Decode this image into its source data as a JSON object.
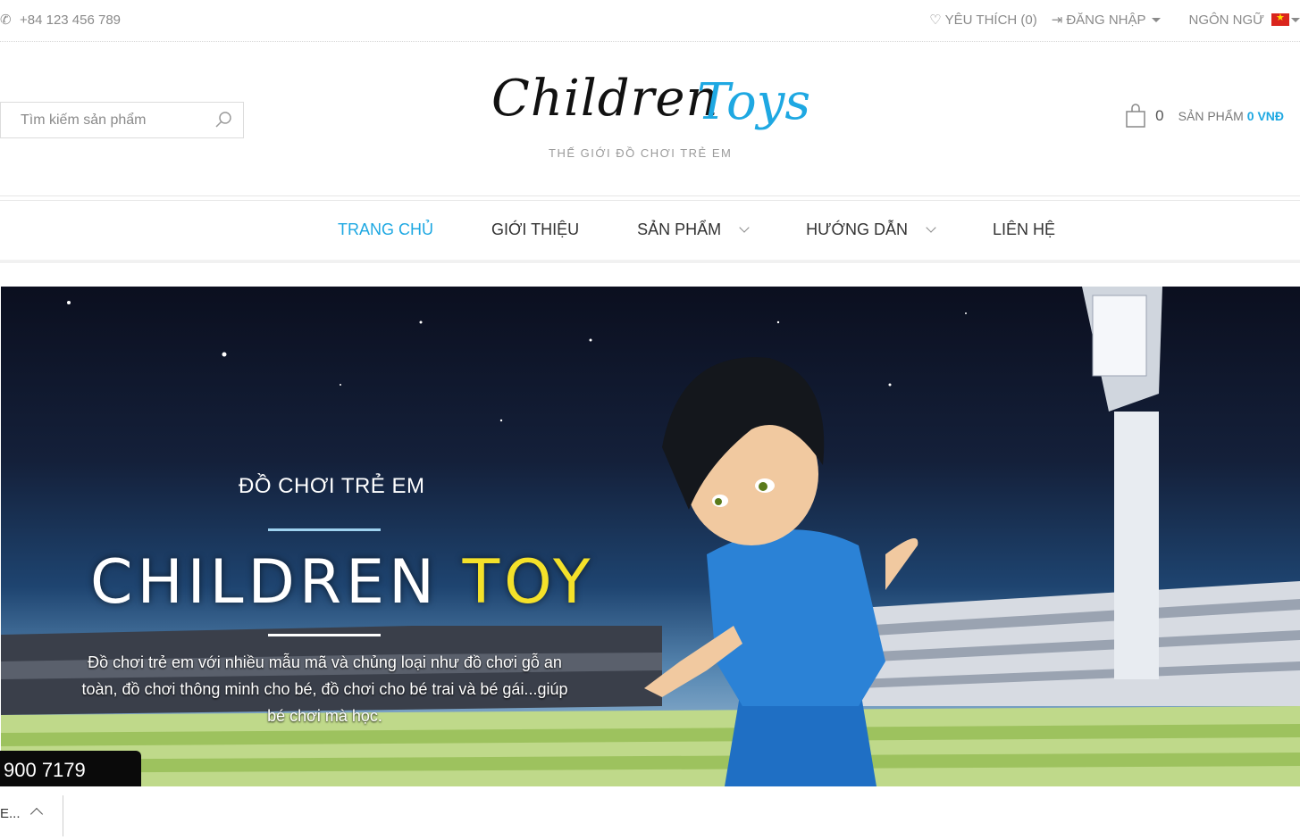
{
  "topbar": {
    "phone_icon": "phone-icon",
    "phone": "+84 123 456 789",
    "wishlist_icon": "heart-icon",
    "wishlist": "YÊU THÍCH (0)",
    "login_icon": "login-icon",
    "login": "ĐĂNG NHẬP",
    "language": "NGÔN NGỮ",
    "flag": "vietnam-flag"
  },
  "header": {
    "search_placeholder": "Tìm kiếm sản phẩm",
    "logo_word1": "Children",
    "logo_word2": "Toys",
    "logo_tagline": "THẾ GIỚI ĐỒ CHƠI TRẺ EM",
    "cart_count": "0",
    "cart_label": "SẢN PHẨM",
    "cart_total": "0 VNĐ"
  },
  "nav": {
    "items": [
      {
        "label": "TRANG CHỦ",
        "active": true,
        "dropdown": false
      },
      {
        "label": "GIỚI THIỆU",
        "active": false,
        "dropdown": false
      },
      {
        "label": "SẢN PHẨM",
        "active": false,
        "dropdown": true
      },
      {
        "label": "HƯỚNG DẪN",
        "active": false,
        "dropdown": true
      },
      {
        "label": "LIÊN HỆ",
        "active": false,
        "dropdown": false
      }
    ]
  },
  "banner": {
    "subtitle": "ĐỒ CHƠI TRẺ EM",
    "title_white": "CHILDREN",
    "title_yellow": "TOY",
    "description": "Đồ chơi trẻ em với nhiều mẫu mã và chủng loại như đồ chơi gỗ an toàn, đồ chơi thông minh cho bé, đồ chơi cho bé trai và bé gái...giúp bé chơi mà học."
  },
  "hotline": "900 7179",
  "bottom": {
    "text": "E..."
  },
  "colors": {
    "accent": "#1ea8e2",
    "title_yellow": "#f4e12a",
    "text_gray": "#8a8a8a"
  }
}
